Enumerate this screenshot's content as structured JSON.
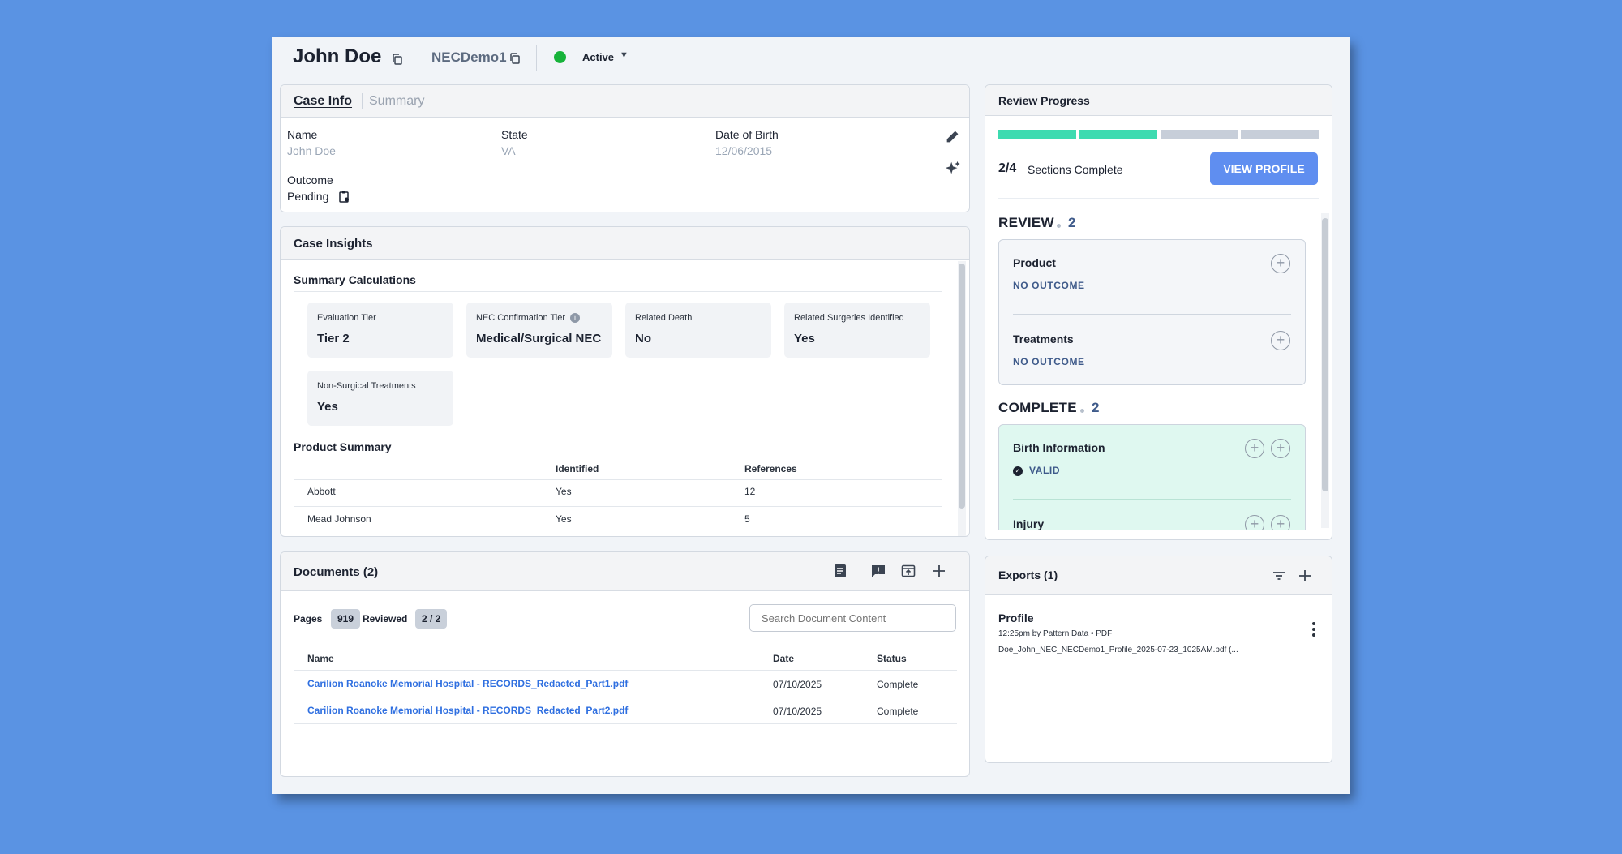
{
  "header": {
    "name": "John Doe",
    "case_id": "NECDemo1",
    "status": "Active",
    "status_color": "#17b33a"
  },
  "case_info": {
    "tabs": [
      "Case Info",
      "Summary"
    ],
    "fields": {
      "name_label": "Name",
      "name_value": "John Doe",
      "state_label": "State",
      "state_value": "VA",
      "dob_label": "Date of Birth",
      "dob_value": "12/06/2015",
      "outcome_label": "Outcome",
      "outcome_value": "Pending"
    }
  },
  "insights": {
    "title": "Case Insights",
    "summary_title": "Summary Calculations",
    "cards": [
      {
        "label": "Evaluation Tier",
        "value": "Tier 2"
      },
      {
        "label": "NEC Confirmation Tier",
        "value": "Medical/Surgical NEC"
      },
      {
        "label": "Related Death",
        "value": "No"
      },
      {
        "label": "Related Surgeries Identified",
        "value": "Yes"
      },
      {
        "label": "Non-Surgical Treatments",
        "value": "Yes"
      }
    ],
    "product_title": "Product Summary",
    "product_columns": [
      "Identified",
      "References"
    ],
    "products": [
      {
        "name": "Abbott",
        "identified": "Yes",
        "references": "12"
      },
      {
        "name": "Mead Johnson",
        "identified": "Yes",
        "references": "5"
      }
    ]
  },
  "documents": {
    "title": "Documents (2)",
    "pages_label": "Pages",
    "pages_value": "919",
    "reviewed_label": "Reviewed",
    "reviewed_value": "2 / 2",
    "search_placeholder": "Search Document Content",
    "columns": [
      "Name",
      "Date",
      "Status"
    ],
    "rows": [
      {
        "name": "Carilion Roanoke Memorial Hospital - RECORDS_Redacted_Part1.pdf",
        "date": "07/10/2025",
        "status": "Complete"
      },
      {
        "name": "Carilion Roanoke Memorial Hospital - RECORDS_Redacted_Part2.pdf",
        "date": "07/10/2025",
        "status": "Complete"
      }
    ]
  },
  "review": {
    "title": "Review Progress",
    "progress": {
      "complete": 2,
      "total": 4
    },
    "progress_count": "2/4",
    "progress_text": "Sections Complete",
    "view_profile": "VIEW PROFILE",
    "accent_complete": "#3ddbb0",
    "accent_pending": "#c7ced9",
    "review_group": {
      "label": "REVIEW",
      "count": "2"
    },
    "review_items": [
      {
        "title": "Product",
        "status": "NO OUTCOME"
      },
      {
        "title": "Treatments",
        "status": "NO OUTCOME"
      }
    ],
    "complete_group": {
      "label": "COMPLETE",
      "count": "2"
    },
    "complete_items": [
      {
        "title": "Birth Information",
        "status": "VALID"
      },
      {
        "title": "Injury",
        "status": ""
      }
    ]
  },
  "exports": {
    "title": "Exports (1)",
    "items": [
      {
        "title": "Profile",
        "meta": "12:25pm by Pattern Data • PDF",
        "file": "Doe_John_NEC_NECDemo1_Profile_2025-07-23_1025AM.pdf (..."
      }
    ]
  }
}
